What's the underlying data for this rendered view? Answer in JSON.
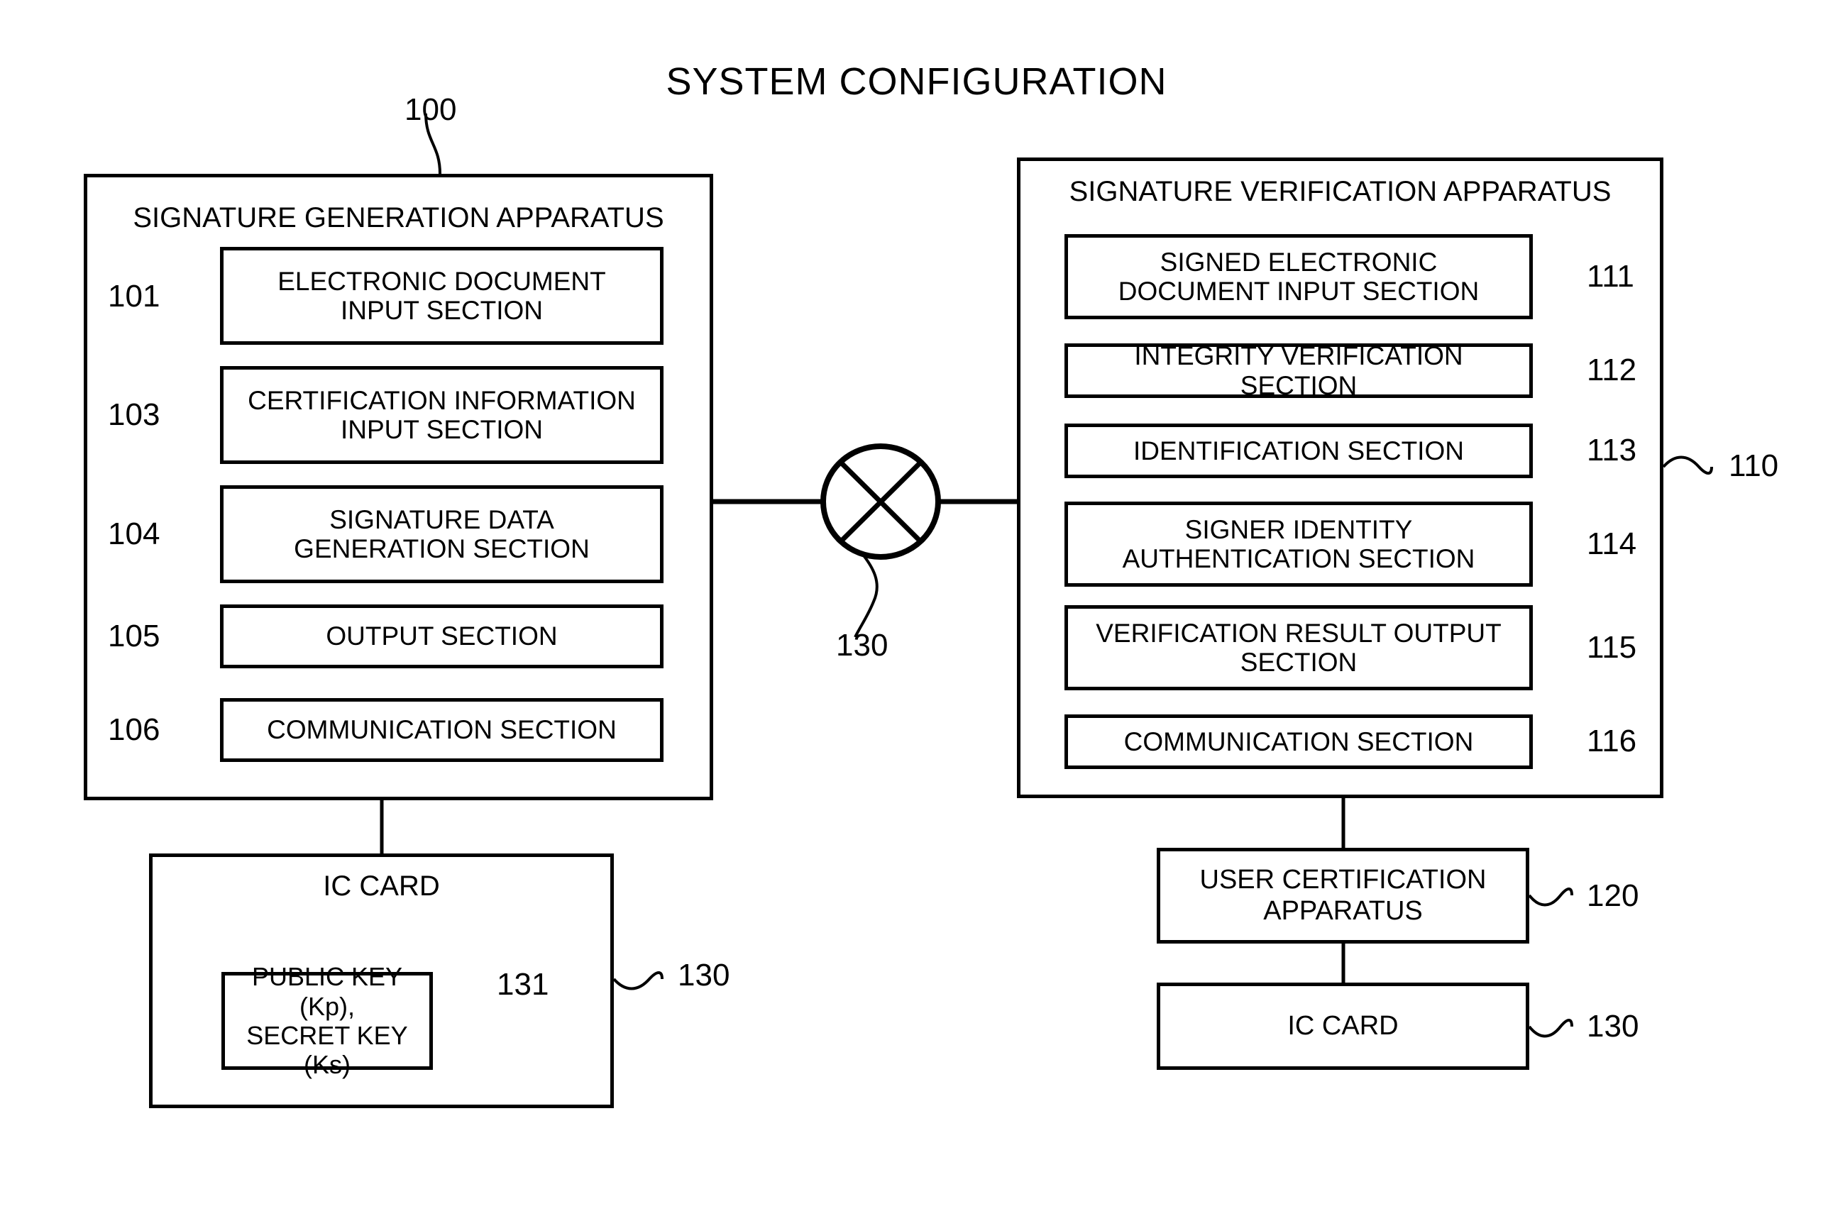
{
  "figure": {
    "title": "SYSTEM CONFIGURATION"
  },
  "generation_apparatus": {
    "ref": "100",
    "heading": "SIGNATURE GENERATION APPARATUS",
    "sections": [
      {
        "ref": "101",
        "line1": "ELECTRONIC DOCUMENT",
        "line2": "INPUT SECTION"
      },
      {
        "ref": "103",
        "line1": "CERTIFICATION INFORMATION",
        "line2": "INPUT SECTION"
      },
      {
        "ref": "104",
        "line1": "SIGNATURE DATA",
        "line2": "GENERATION SECTION"
      },
      {
        "ref": "105",
        "line1": "OUTPUT SECTION",
        "line2": ""
      },
      {
        "ref": "106",
        "line1": "COMMUNICATION SECTION",
        "line2": ""
      }
    ]
  },
  "verification_apparatus": {
    "ref": "110",
    "heading": "SIGNATURE VERIFICATION APPARATUS",
    "sections": [
      {
        "ref": "111",
        "line1": "SIGNED ELECTRONIC",
        "line2": "DOCUMENT INPUT SECTION"
      },
      {
        "ref": "112",
        "line1": "INTEGRITY VERIFICATION SECTION",
        "line2": ""
      },
      {
        "ref": "113",
        "line1": "IDENTIFICATION SECTION",
        "line2": ""
      },
      {
        "ref": "114",
        "line1": "SIGNER IDENTITY",
        "line2": "AUTHENTICATION SECTION"
      },
      {
        "ref": "115",
        "line1": "VERIFICATION RESULT OUTPUT",
        "line2": "SECTION"
      },
      {
        "ref": "116",
        "line1": "COMMUNICATION SECTION",
        "line2": ""
      }
    ]
  },
  "network": {
    "ref": "130",
    "icon": "network-cross-circle-icon"
  },
  "ic_card_left": {
    "ref": "130",
    "heading": "IC CARD",
    "storage_icon": "database-cylinder-icon",
    "key_store": {
      "ref": "131",
      "line1": "PUBLIC KEY (Kp),",
      "line2": "SECRET KEY (Ks)"
    }
  },
  "user_certification_apparatus": {
    "ref": "120",
    "line1": "USER CERTIFICATION",
    "line2": "APPARATUS"
  },
  "ic_card_right": {
    "ref": "130",
    "label": "IC CARD"
  },
  "colors": {
    "stroke": "#000000",
    "background": "#ffffff"
  }
}
